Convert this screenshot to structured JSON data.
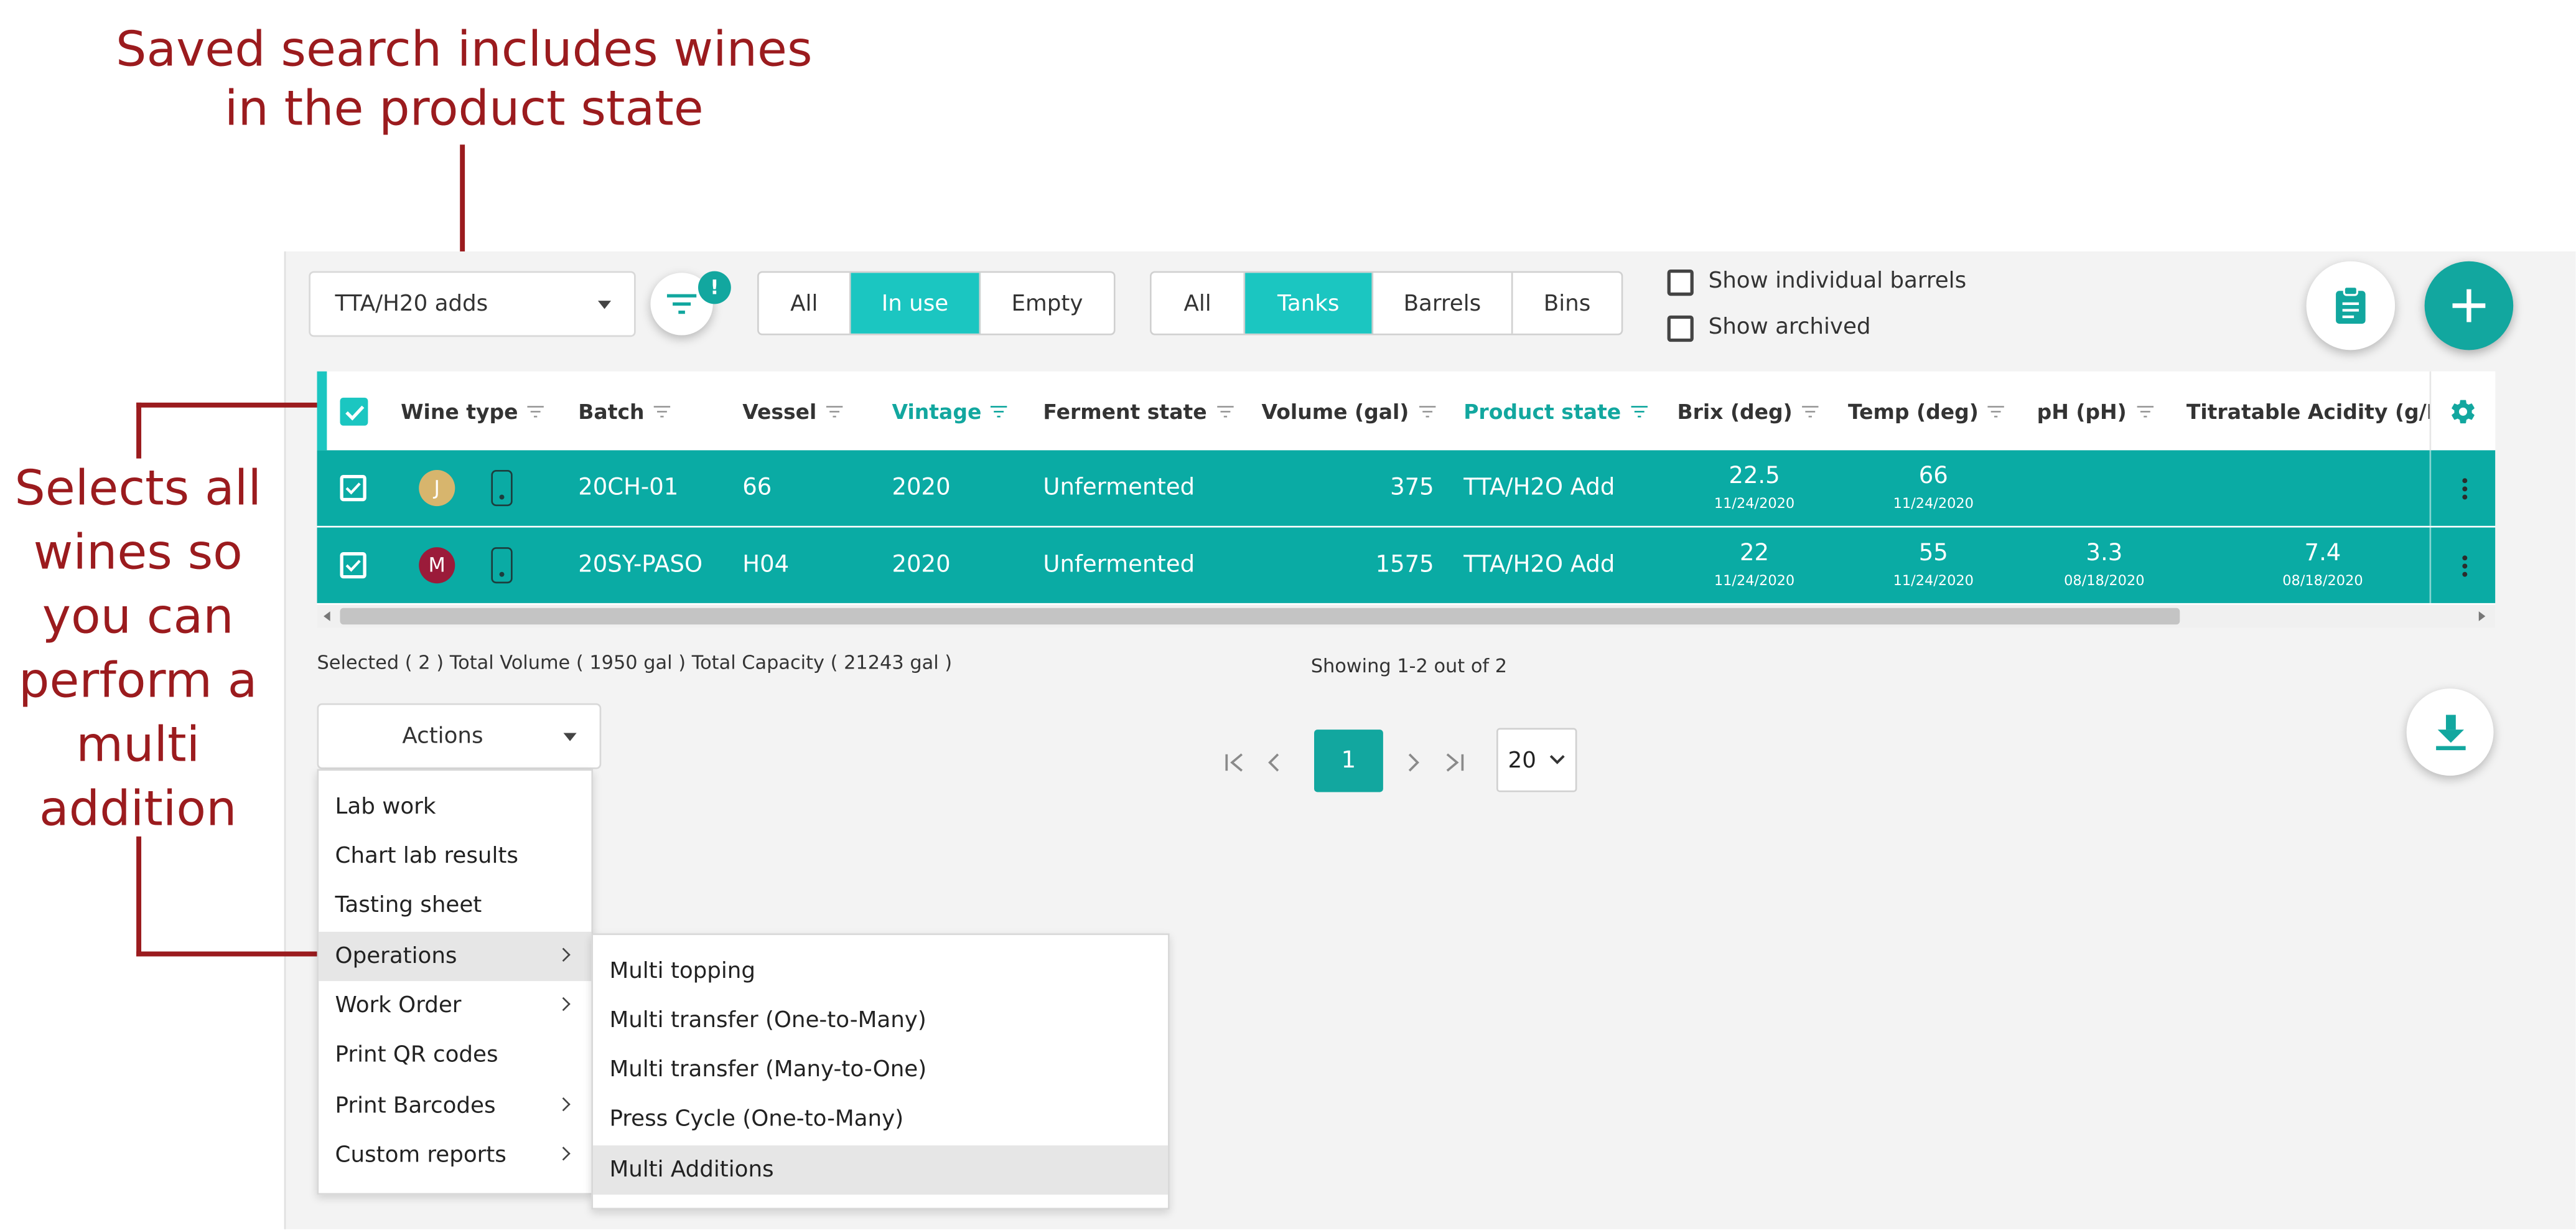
{
  "annotations": {
    "top": [
      "Saved search includes wines",
      "in the product state"
    ],
    "left": [
      "Selects all",
      "wines so",
      "you can",
      "perform a",
      "multi",
      "addition"
    ]
  },
  "colors": {
    "annotation": "#9b1b1e",
    "teal": "#1bc6c1",
    "row_teal": "#0aaba4",
    "gold_avatar": "#d7b56d",
    "maroon_avatar": "#9b1b3a"
  },
  "toolbar": {
    "saved_search": "TTA/H20 adds",
    "filter_badge": "!",
    "state_filter": {
      "options": [
        "All",
        "In use",
        "Empty"
      ],
      "selected": "In use"
    },
    "vessel_filter": {
      "options": [
        "All",
        "Tanks",
        "Barrels",
        "Bins"
      ],
      "selected": "Tanks"
    },
    "show_individual_barrels": "Show individual barrels",
    "show_archived": "Show archived",
    "icons": {
      "filter": "filter-icon",
      "clipboard": "clipboard-icon",
      "add": "plus-icon",
      "download": "download-icon",
      "settings": "gear-icon"
    }
  },
  "table": {
    "columns": [
      "Wine type",
      "Batch",
      "Vessel",
      "Vintage",
      "Ferment state",
      "Volume (gal)",
      "Product state",
      "Brix (deg)",
      "Temp (deg)",
      "pH (pH)",
      "Titratable Acidity (g/L)"
    ],
    "rows": [
      {
        "avatar": "J",
        "batch": "20CH-01",
        "vessel": "66",
        "vintage": "2020",
        "ferment": "Unfermented",
        "volume": "375",
        "product": "TTA/H2O Add",
        "brix": "22.5",
        "brix_date": "11/24/2020",
        "temp": "66",
        "temp_date": "11/24/2020",
        "ph": "",
        "ph_date": "",
        "ta": "",
        "ta_date": ""
      },
      {
        "avatar": "M",
        "batch": "20SY-PASO",
        "vessel": "H04",
        "vintage": "2020",
        "ferment": "Unfermented",
        "volume": "1575",
        "product": "TTA/H2O Add",
        "brix": "22",
        "brix_date": "11/24/2020",
        "temp": "55",
        "temp_date": "11/24/2020",
        "ph": "3.3",
        "ph_date": "08/18/2020",
        "ta": "7.4",
        "ta_date": "08/18/2020"
      }
    ]
  },
  "summary": "Selected ( 2 ) Total Volume ( 1950 gal ) Total Capacity ( 21243 gal )",
  "showing": "Showing 1-2 out of 2",
  "pagination": {
    "current": "1",
    "page_size": "20"
  },
  "actions": {
    "label": "Actions",
    "menu": [
      "Lab work",
      "Chart lab results",
      "Tasting sheet",
      "Operations",
      "Work Order",
      "Print QR codes",
      "Print Barcodes",
      "Custom reports"
    ],
    "submenu": [
      "Multi topping",
      "Multi transfer (One-to-Many)",
      "Multi transfer (Many-to-One)",
      "Press Cycle (One-to-Many)",
      "Multi Additions"
    ]
  }
}
